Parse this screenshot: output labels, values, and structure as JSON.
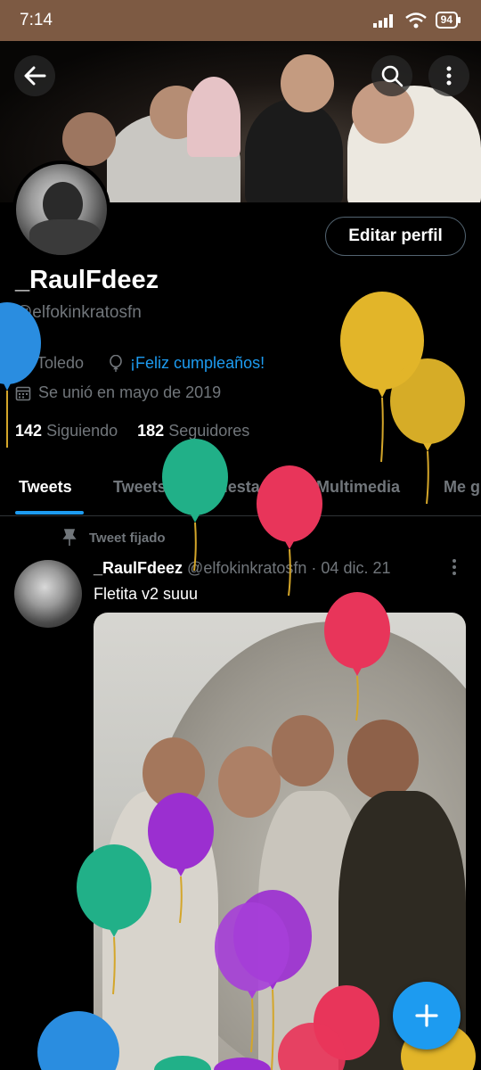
{
  "status_bar": {
    "time": "7:14",
    "battery": "94"
  },
  "profile": {
    "display_name": "_RaulFdeez",
    "handle": "@elfokinkratosfn",
    "location": "Toledo",
    "birthday": "¡Feliz cumpleaños!",
    "joined": "Se unió en mayo de 2019",
    "following_count": "142",
    "following_label": "Siguiendo",
    "followers_count": "182",
    "followers_label": "Seguidores",
    "edit_button": "Editar perfil"
  },
  "tabs": [
    {
      "label": "Tweets"
    },
    {
      "label": "Tweets y respuestas"
    },
    {
      "label": "Multimedia"
    },
    {
      "label": "Me g"
    }
  ],
  "pinned_label": "Tweet fijado",
  "tweet": {
    "author": "_RaulFdeez",
    "handle": "@elfokinkratosfn",
    "separator": "·",
    "date": "04 dic. 21",
    "text": "Fletita v2 suuu"
  },
  "icons": {
    "back": "back-arrow-icon",
    "search": "search-icon",
    "more": "more-vertical-icon",
    "location": "location-pin-icon",
    "balloon": "balloon-icon",
    "calendar": "calendar-icon",
    "pin": "pin-icon",
    "fab": "plus-icon"
  },
  "colors": {
    "accent": "#1d9bf0",
    "status_bar": "#7d5a43",
    "background": "#000000",
    "muted_text": "#71767b"
  }
}
